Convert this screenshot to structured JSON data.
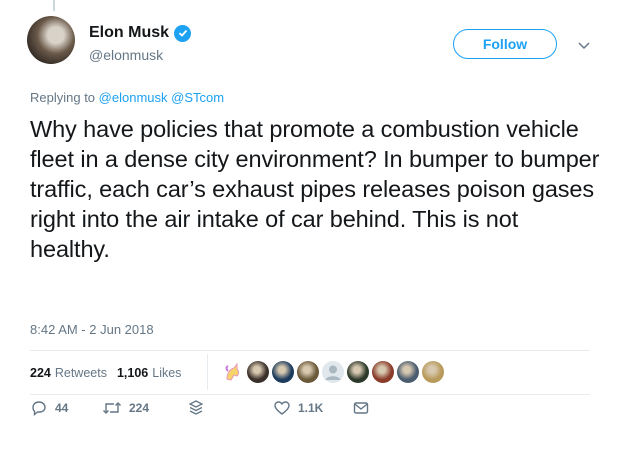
{
  "author": {
    "name": "Elon Musk",
    "handle": "@elonmusk",
    "verified": true
  },
  "follow_label": "Follow",
  "reply_context": {
    "prefix": "Replying to",
    "mentions": "@elonmusk @STcom"
  },
  "tweet_text": "Why have policies that promote a combustion vehicle fleet in a dense city environment? In bumper to bumper traffic, each car’s exhaust pipes releases poison gases right into the air intake of car behind. This is not healthy.",
  "timestamp": "8:42 AM - 2 Jun 2018",
  "stats": {
    "retweets_count": "224",
    "retweets_label": "Retweets",
    "likes_count": "1,106",
    "likes_label": "Likes"
  },
  "likers": [
    {
      "icon": "unicorn-avatar",
      "color": "#f7d36b"
    },
    {
      "icon": "avatar",
      "color": "#3b2f2a"
    },
    {
      "icon": "avatar",
      "color": "#1d3b5c"
    },
    {
      "icon": "avatar",
      "color": "#6b5a3a"
    },
    {
      "icon": "default-avatar",
      "color": "#aab8c2"
    },
    {
      "icon": "avatar",
      "color": "#2d3a2a"
    },
    {
      "icon": "avatar",
      "color": "#8a3b2a"
    },
    {
      "icon": "avatar",
      "color": "#4a5c6e"
    },
    {
      "icon": "avatar",
      "color": "#b89a5a"
    }
  ],
  "actions": {
    "reply_count": "44",
    "retweet_count": "224",
    "like_count": "1.1K"
  },
  "colors": {
    "accent": "#1da1f2",
    "text": "#14171a",
    "muted": "#657786"
  }
}
